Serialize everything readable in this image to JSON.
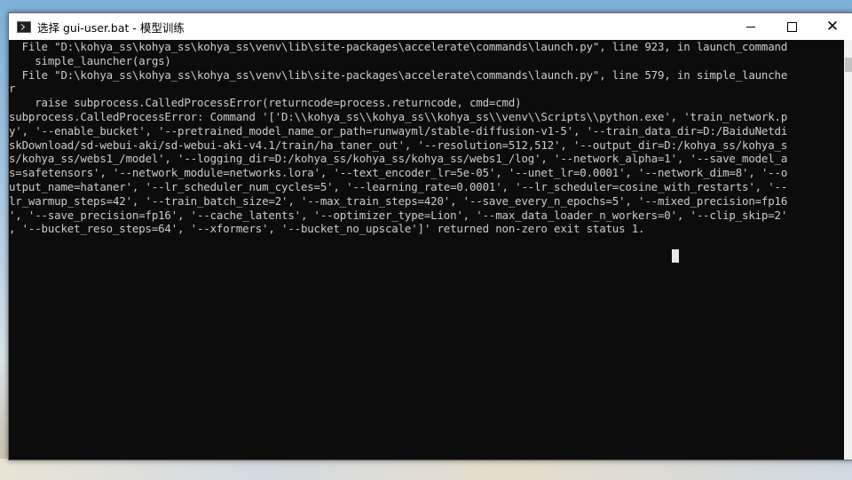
{
  "window": {
    "title": "选择 gui-user.bat - 模型训练",
    "app_icon": "cmd-icon",
    "controls": {
      "minimize": "—",
      "maximize": "☐",
      "close": "✕"
    }
  },
  "console": {
    "lines": [
      "  File \"D:\\kohya_ss\\kohya_ss\\kohya_ss\\venv\\lib\\site-packages\\accelerate\\commands\\launch.py\", line 923, in launch_command",
      "    simple_launcher(args)",
      "  File \"D:\\kohya_ss\\kohya_ss\\kohya_ss\\venv\\lib\\site-packages\\accelerate\\commands\\launch.py\", line 579, in simple_launche",
      "r",
      "    raise subprocess.CalledProcessError(returncode=process.returncode, cmd=cmd)",
      "subprocess.CalledProcessError: Command '['D:\\\\kohya_ss\\\\kohya_ss\\\\kohya_ss\\\\venv\\\\Scripts\\\\python.exe', 'train_network.p",
      "y', '--enable_bucket', '--pretrained_model_name_or_path=runwayml/stable-diffusion-v1-5', '--train_data_dir=D:/BaiduNetdi",
      "skDownload/sd-webui-aki/sd-webui-aki-v4.1/train/ha_taner_out', '--resolution=512,512', '--output_dir=D:/kohya_ss/kohya_s",
      "s/kohya_ss/webs1_/model', '--logging_dir=D:/kohya_ss/kohya_ss/kohya_ss/webs1_/log', '--network_alpha=1', '--save_model_a",
      "s=safetensors', '--network_module=networks.lora', '--text_encoder_lr=5e-05', '--unet_lr=0.0001', '--network_dim=8', '--o",
      "utput_name=hataner', '--lr_scheduler_num_cycles=5', '--learning_rate=0.0001', '--lr_scheduler=cosine_with_restarts', '--",
      "lr_warmup_steps=42', '--train_batch_size=2', '--max_train_steps=420', '--save_every_n_epochs=5', '--mixed_precision=fp16",
      "', '--save_precision=fp16', '--cache_latents', '--optimizer_type=Lion', '--max_data_loader_n_workers=0', '--clip_skip=2'",
      ", '--bucket_reso_steps=64', '--xformers', '--bucket_no_upscale']' returned non-zero exit status 1."
    ]
  },
  "colors": {
    "console_bg": "#0c0c0c",
    "console_text": "#cccccc",
    "titlebar_bg": "#ffffff"
  }
}
